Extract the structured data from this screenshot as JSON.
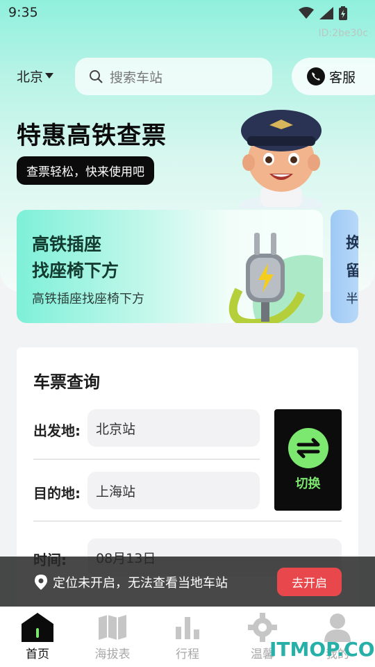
{
  "status_bar": {
    "time": "9:35",
    "id_text": "ID:2be30c"
  },
  "header": {
    "city": "北京",
    "search_placeholder": "搜索车站",
    "service_label": "客服"
  },
  "hero": {
    "title": "特惠高铁查票",
    "subtitle": "查票轻松，快来使用吧"
  },
  "banners": [
    {
      "line1": "高铁插座",
      "line2": "找座椅下方",
      "desc": "高铁插座找座椅下方"
    },
    {
      "line1": "换",
      "line2": "留",
      "desc": "半"
    }
  ],
  "ticket_query": {
    "title": "车票查询",
    "from_label": "出发地:",
    "from_value": "北京站",
    "to_label": "目的地:",
    "to_value": "上海站",
    "time_label": "时间:",
    "time_value": "08月13日",
    "swap_label": "切换"
  },
  "toast": {
    "message": "定位未开启，无法查看当地车站",
    "button": "去开启"
  },
  "nav": {
    "items": [
      {
        "label": "首页",
        "icon": "home-icon"
      },
      {
        "label": "海拔表",
        "icon": "map-icon"
      },
      {
        "label": "行程",
        "icon": "bar-chart-icon"
      },
      {
        "label": "温馨",
        "icon": "gear-icon"
      },
      {
        "label": "我的",
        "icon": "user-icon"
      }
    ]
  },
  "watermark": "ITMOP.COM",
  "colors": {
    "accent_green": "#7de86f",
    "toast_button": "#e8484c",
    "hero_mint": "#8ff0dc"
  }
}
